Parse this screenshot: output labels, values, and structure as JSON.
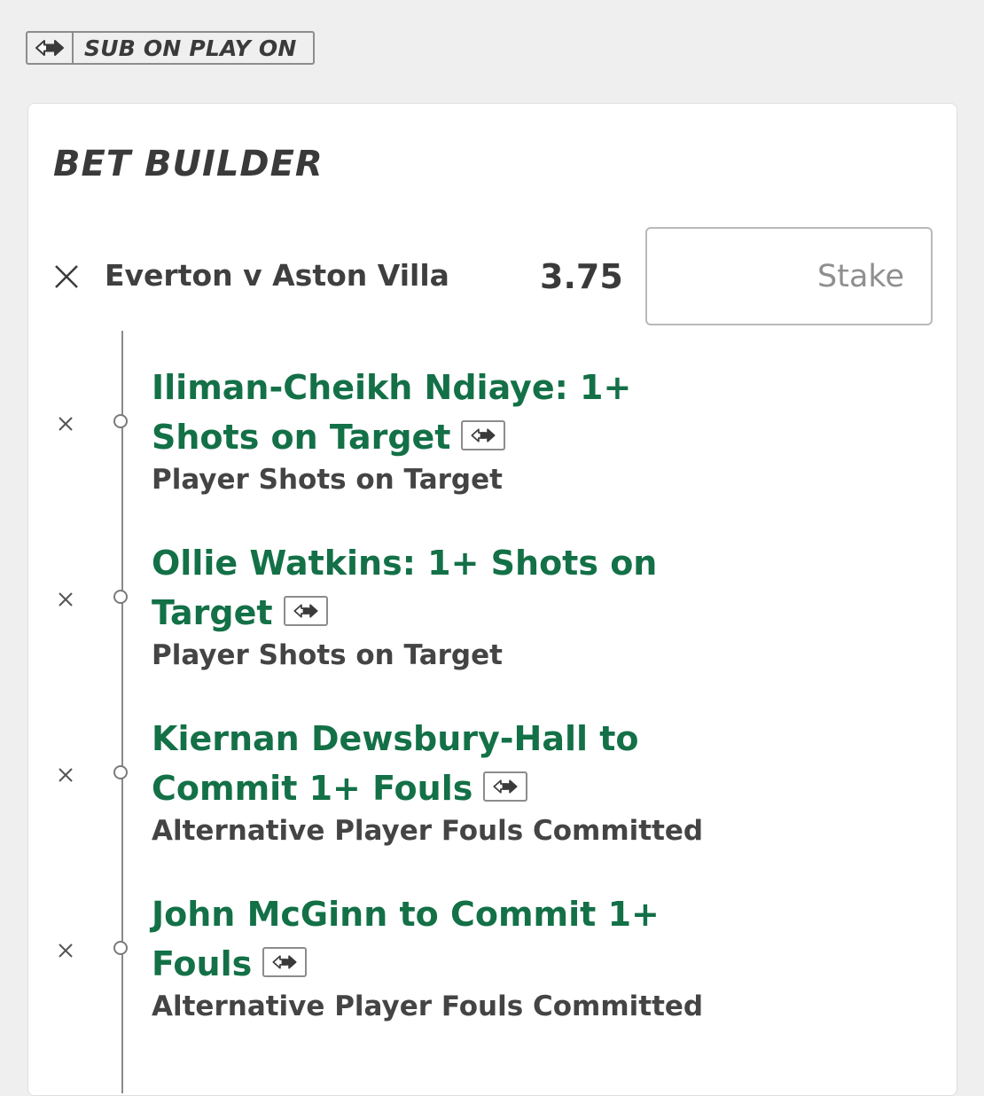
{
  "badge": {
    "icon": "sub-on-play-on-icon",
    "label": "SUB ON PLAY ON"
  },
  "bet_builder": {
    "title": "BET BUILDER",
    "event": {
      "name": "Everton v Aston Villa",
      "odds": "3.75",
      "stake_placeholder": "Stake",
      "stake_value": "",
      "remove_icon": "close-icon"
    },
    "legs": [
      {
        "selection": "Iliman-Cheikh Ndiaye: 1+ Shots on Target",
        "market": "Player Shots on Target",
        "sub_icon": "sub-on-play-on-icon",
        "remove_icon": "close-icon"
      },
      {
        "selection": "Ollie Watkins: 1+ Shots on Target",
        "market": "Player Shots on Target",
        "sub_icon": "sub-on-play-on-icon",
        "remove_icon": "close-icon"
      },
      {
        "selection": "Kiernan Dewsbury-Hall to Commit 1+ Fouls",
        "market": "Alternative Player Fouls Committed",
        "sub_icon": "sub-on-play-on-icon",
        "remove_icon": "close-icon"
      },
      {
        "selection": "John McGinn to Commit 1+ Fouls",
        "market": "Alternative Player Fouls Committed",
        "sub_icon": "sub-on-play-on-icon",
        "remove_icon": "close-icon"
      }
    ]
  },
  "colors": {
    "page_background": "#efefef",
    "card_background": "#ffffff",
    "selection_green": "#137047",
    "text_dark": "#3a3a3a",
    "border_grey": "#8c8c8c"
  }
}
